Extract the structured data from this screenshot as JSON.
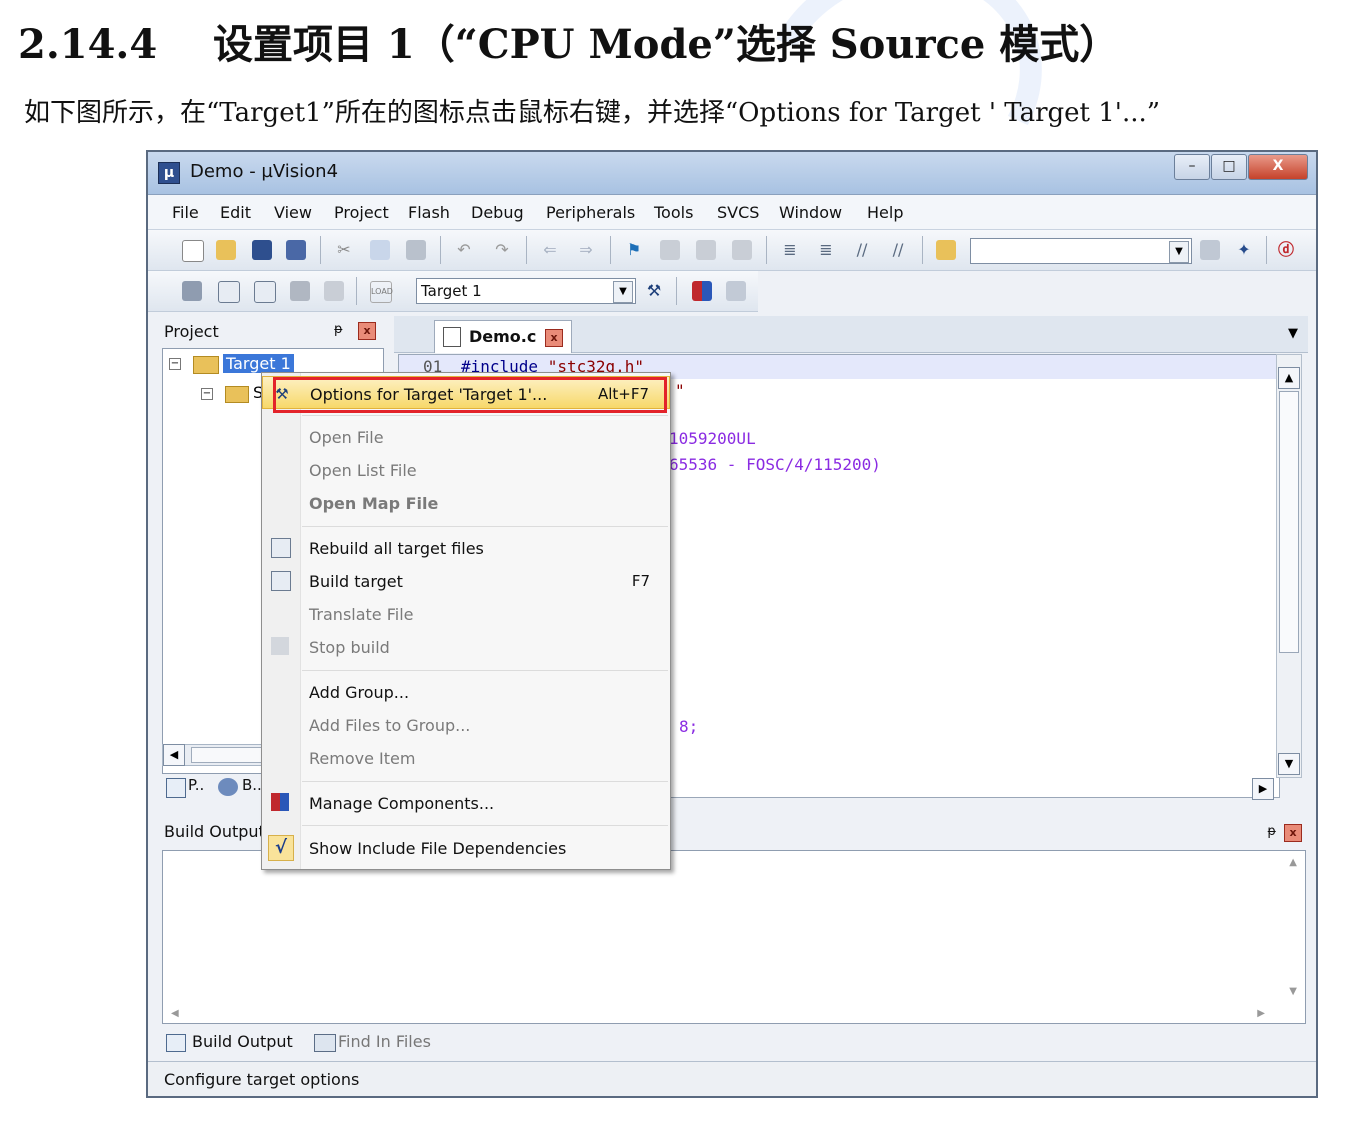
{
  "doc": {
    "section_number": "2.14.4",
    "section_title": "设置项目 1（“CPU Mode”选择 Source 模式）",
    "intro": "如下图所示，在“Target1”所在的图标点击鼠标右键，并选择“Options for Target ' Target 1'...”"
  },
  "window": {
    "title": "Demo  - µVision4",
    "app_icon": "µ",
    "minimize": "–",
    "maximize": "□",
    "close": "X"
  },
  "menu": [
    "File",
    "Edit",
    "View",
    "Project",
    "Flash",
    "Debug",
    "Peripherals",
    "Tools",
    "SVCS",
    "Window",
    "Help"
  ],
  "toolbar2": {
    "target_select": "Target 1",
    "load_label": "LOAD"
  },
  "project_pane": {
    "title": "Project",
    "pin": "ᵽ",
    "close": "x",
    "target_node": "Target 1",
    "group_letter": "S",
    "tabs": [
      "P..",
      "B.."
    ]
  },
  "editor": {
    "tab_label": "Demo.c",
    "tab_close": "x",
    "line_number": "01",
    "lines": [
      {
        "kw": "#include ",
        "str": "\"stc32g.h\""
      },
      {
        "kw": "",
        "str": "\""
      },
      {
        "kw": "",
        "str": "1059200UL"
      },
      {
        "kw": "",
        "str": "65536 - FOSC/4/115200)"
      },
      {
        "kw": "",
        "str": "8;"
      }
    ]
  },
  "context_menu": {
    "items": [
      {
        "label": "Options for Target 'Target 1'...",
        "shortcut": "Alt+F7",
        "highlighted": true
      },
      {
        "label": "Open File",
        "disabled": true
      },
      {
        "label": "Open List File",
        "disabled": true
      },
      {
        "label": "Open Map File",
        "disabled": true
      },
      {
        "label": "Rebuild all target files"
      },
      {
        "label": "Build target",
        "shortcut": "F7"
      },
      {
        "label": "Translate File",
        "disabled": true
      },
      {
        "label": "Stop build",
        "disabled": true
      },
      {
        "label": "Add Group..."
      },
      {
        "label": "Add Files to Group...",
        "disabled": true
      },
      {
        "label": "Remove Item",
        "disabled": true
      },
      {
        "label": "Manage Components..."
      },
      {
        "label": "Show Include File Dependencies",
        "checked": true
      }
    ],
    "check_mark": "√"
  },
  "build_output": {
    "title": "Build Output",
    "tabs": [
      "Build Output",
      "Find In Files"
    ]
  },
  "status_bar": {
    "text": "Configure target options"
  },
  "colors": {
    "highlight_box": "#e3232a",
    "selection": "#3b77d9"
  }
}
